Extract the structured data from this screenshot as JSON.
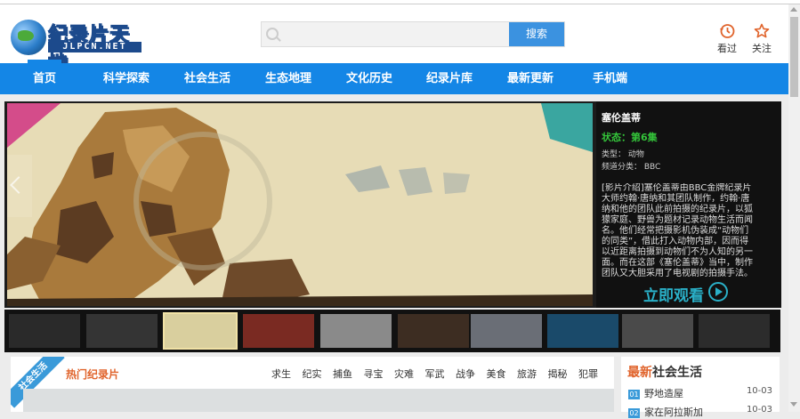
{
  "header": {
    "logo_title": "纪录片天地",
    "logo_sub": "JLPCN.NET",
    "search_placeholder": "",
    "search_button": "搜索",
    "history_label": "看过",
    "follow_label": "关注"
  },
  "nav": {
    "items": [
      "首页",
      "科学探索",
      "社会生活",
      "生态地理",
      "文化历史",
      "纪录片库",
      "最新更新",
      "手机端"
    ]
  },
  "banner": {
    "title": "塞伦盖蒂",
    "state": "状态：第6集",
    "type": "类型：  动物",
    "channel": "频道分类：  BBC",
    "description": "[影片介绍]塞伦盖蒂由BBC金牌纪录片大师约翰·唐纳和其团队制作，约翰·唐纳和他的团队此前拍摄的纪录片，以狐獴家庭、野兽为题材记录动物生活而闻名。他们经常把摄影机伪装成“动物们的同类”，借此打入动物内部，因而得以近距离拍摄到动物们不为人知的另一面。而在这部《塞伦盖蒂》当中，制作团队又大胆采用了电视剧的拍摄手法。",
    "watch_label": "立即观看"
  },
  "section": {
    "ribbon": "社会生活",
    "hot_label": "热门纪录片",
    "tags": [
      "求生",
      "纪实",
      "捕鱼",
      "寻宝",
      "灾难",
      "军武",
      "战争",
      "美食",
      "旅游",
      "揭秘",
      "犯罪"
    ]
  },
  "side": {
    "title_prefix": "最新",
    "title_suffix": "社会生活",
    "items": [
      {
        "num": "01",
        "title": "野地造屋",
        "date": "10-03"
      },
      {
        "num": "02",
        "title": "家在阿拉斯加",
        "date": "10-03"
      }
    ]
  },
  "colors": {
    "nav": "#1486e6",
    "accent": "#e0632b",
    "state": "#34c43a",
    "watch": "#2ab0c8"
  }
}
